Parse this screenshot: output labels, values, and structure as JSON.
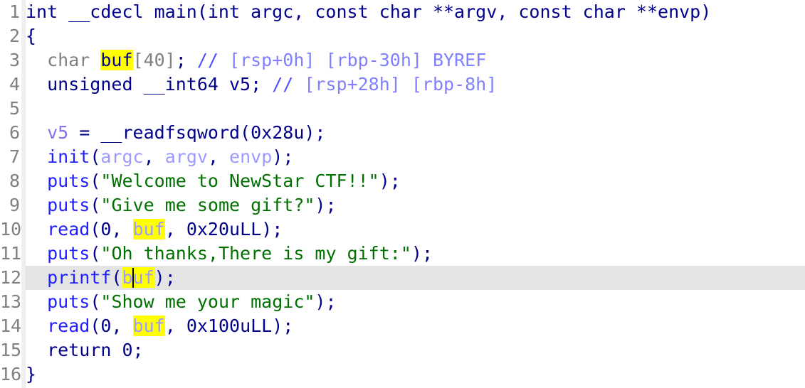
{
  "view": {
    "name": "hexrays-pseudocode",
    "theme": "light",
    "font_size_px": 25,
    "line_height_px": 34,
    "total_lines": 16,
    "current_line": 12,
    "highlighted_identifier": "buf",
    "colors": {
      "background": "#ffffff",
      "gutter": "#f0f0f0",
      "gutter_text": "#808080",
      "current_line_highlight": "#e4e4e4",
      "keyword": "#00008b",
      "function": "#2020ff",
      "string": "#007000",
      "comment": "#5050ff",
      "comment_light": "#8080ff",
      "variable": "#8a6fe8",
      "argument": "#9a9aff",
      "type_gray": "#808080",
      "identifier_highlight_bg": "#ffff00",
      "cursor": "#000000"
    }
  },
  "lines": [
    {
      "num": "1",
      "current": false,
      "tokens": [
        {
          "t": "int __cdecl main(int argc, const char **argv, const char **envp)",
          "c": "tok-keyword"
        }
      ]
    },
    {
      "num": "2",
      "current": false,
      "tokens": [
        {
          "t": "{",
          "c": "tok-default"
        }
      ]
    },
    {
      "num": "3",
      "current": false,
      "tokens": [
        {
          "t": "  char ",
          "c": "tok-gray"
        },
        {
          "t": "buf",
          "c": "tok-keyword",
          "hl": true
        },
        {
          "t": "[40]",
          "c": "tok-gray"
        },
        {
          "t": ";",
          "c": "tok-default"
        },
        {
          "t": " ",
          "c": "tok-default"
        },
        {
          "t": "//",
          "c": "tok-comment"
        },
        {
          "t": " [rsp+0h] [rbp-30h] BYREF",
          "c": "tok-cmtlight"
        }
      ]
    },
    {
      "num": "4",
      "current": false,
      "tokens": [
        {
          "t": "  unsigned __int64 v5;",
          "c": "tok-keyword"
        },
        {
          "t": " ",
          "c": "tok-default"
        },
        {
          "t": "//",
          "c": "tok-comment"
        },
        {
          "t": " [rsp+28h] [rbp-8h]",
          "c": "tok-cmtlight"
        }
      ]
    },
    {
      "num": "5",
      "current": false,
      "tokens": []
    },
    {
      "num": "6",
      "current": false,
      "tokens": [
        {
          "t": "  ",
          "c": "tok-default"
        },
        {
          "t": "v5",
          "c": "tok-var"
        },
        {
          "t": " = ",
          "c": "tok-default"
        },
        {
          "t": "__readfsqword",
          "c": "tok-keyword"
        },
        {
          "t": "(",
          "c": "tok-default"
        },
        {
          "t": "0x28u",
          "c": "tok-number"
        },
        {
          "t": ");",
          "c": "tok-default"
        }
      ]
    },
    {
      "num": "7",
      "current": false,
      "tokens": [
        {
          "t": "  ",
          "c": "tok-default"
        },
        {
          "t": "init",
          "c": "tok-func"
        },
        {
          "t": "(",
          "c": "tok-default"
        },
        {
          "t": "argc",
          "c": "tok-arg"
        },
        {
          "t": ", ",
          "c": "tok-default"
        },
        {
          "t": "argv",
          "c": "tok-arg"
        },
        {
          "t": ", ",
          "c": "tok-default"
        },
        {
          "t": "envp",
          "c": "tok-arg"
        },
        {
          "t": ");",
          "c": "tok-default"
        }
      ]
    },
    {
      "num": "8",
      "current": false,
      "tokens": [
        {
          "t": "  ",
          "c": "tok-default"
        },
        {
          "t": "puts",
          "c": "tok-func"
        },
        {
          "t": "(",
          "c": "tok-default"
        },
        {
          "t": "\"Welcome to NewStar CTF!!\"",
          "c": "tok-string"
        },
        {
          "t": ");",
          "c": "tok-default"
        }
      ]
    },
    {
      "num": "9",
      "current": false,
      "tokens": [
        {
          "t": "  ",
          "c": "tok-default"
        },
        {
          "t": "puts",
          "c": "tok-func"
        },
        {
          "t": "(",
          "c": "tok-default"
        },
        {
          "t": "\"Give me some gift?\"",
          "c": "tok-string"
        },
        {
          "t": ");",
          "c": "tok-default"
        }
      ]
    },
    {
      "num": "10",
      "current": false,
      "tokens": [
        {
          "t": "  ",
          "c": "tok-default"
        },
        {
          "t": "read",
          "c": "tok-func"
        },
        {
          "t": "(",
          "c": "tok-default"
        },
        {
          "t": "0",
          "c": "tok-number"
        },
        {
          "t": ", ",
          "c": "tok-default"
        },
        {
          "t": "buf",
          "c": "tok-arg",
          "hl": true
        },
        {
          "t": ", ",
          "c": "tok-default"
        },
        {
          "t": "0x20uLL",
          "c": "tok-number"
        },
        {
          "t": ");",
          "c": "tok-default"
        }
      ]
    },
    {
      "num": "11",
      "current": false,
      "tokens": [
        {
          "t": "  ",
          "c": "tok-default"
        },
        {
          "t": "puts",
          "c": "tok-func"
        },
        {
          "t": "(",
          "c": "tok-default"
        },
        {
          "t": "\"Oh thanks,There is my gift:\"",
          "c": "tok-string"
        },
        {
          "t": ");",
          "c": "tok-default"
        }
      ]
    },
    {
      "num": "12",
      "current": true,
      "tokens": [
        {
          "t": "  ",
          "c": "tok-default"
        },
        {
          "t": "printf",
          "c": "tok-func"
        },
        {
          "t": "(",
          "c": "tok-default"
        },
        {
          "t": "b",
          "c": "tok-arg",
          "hl": true
        },
        {
          "t": "",
          "c": "cursor"
        },
        {
          "t": "uf",
          "c": "tok-arg",
          "hl": true
        },
        {
          "t": ");",
          "c": "tok-default"
        }
      ]
    },
    {
      "num": "13",
      "current": false,
      "tokens": [
        {
          "t": "  ",
          "c": "tok-default"
        },
        {
          "t": "puts",
          "c": "tok-func"
        },
        {
          "t": "(",
          "c": "tok-default"
        },
        {
          "t": "\"Show me your magic\"",
          "c": "tok-string"
        },
        {
          "t": ");",
          "c": "tok-default"
        }
      ]
    },
    {
      "num": "14",
      "current": false,
      "tokens": [
        {
          "t": "  ",
          "c": "tok-default"
        },
        {
          "t": "read",
          "c": "tok-func"
        },
        {
          "t": "(",
          "c": "tok-default"
        },
        {
          "t": "0",
          "c": "tok-number"
        },
        {
          "t": ", ",
          "c": "tok-default"
        },
        {
          "t": "buf",
          "c": "tok-arg",
          "hl": true
        },
        {
          "t": ", ",
          "c": "tok-default"
        },
        {
          "t": "0x100uLL",
          "c": "tok-number"
        },
        {
          "t": ");",
          "c": "tok-default"
        }
      ]
    },
    {
      "num": "15",
      "current": false,
      "tokens": [
        {
          "t": "  ",
          "c": "tok-default"
        },
        {
          "t": "return",
          "c": "tok-keyword"
        },
        {
          "t": " ",
          "c": "tok-default"
        },
        {
          "t": "0",
          "c": "tok-number"
        },
        {
          "t": ";",
          "c": "tok-default"
        }
      ]
    },
    {
      "num": "16",
      "current": false,
      "tokens": [
        {
          "t": "}",
          "c": "tok-default"
        }
      ]
    }
  ],
  "source_text": {
    "full": "int __cdecl main(int argc, const char **argv, const char **envp)\n{\n  char buf[40]; // [rsp+0h] [rbp-30h] BYREF\n  unsigned __int64 v5; // [rsp+28h] [rbp-8h]\n\n  v5 = __readfsqword(0x28u);\n  init(argc, argv, envp);\n  puts(\"Welcome to NewStar CTF!!\");\n  puts(\"Give me some gift?\");\n  read(0, buf, 0x20uLL);\n  puts(\"Oh thanks,There is my gift:\");\n  printf(buf);\n  puts(\"Show me your magic\");\n  read(0, buf, 0x100uLL);\n  return 0;\n}"
  }
}
